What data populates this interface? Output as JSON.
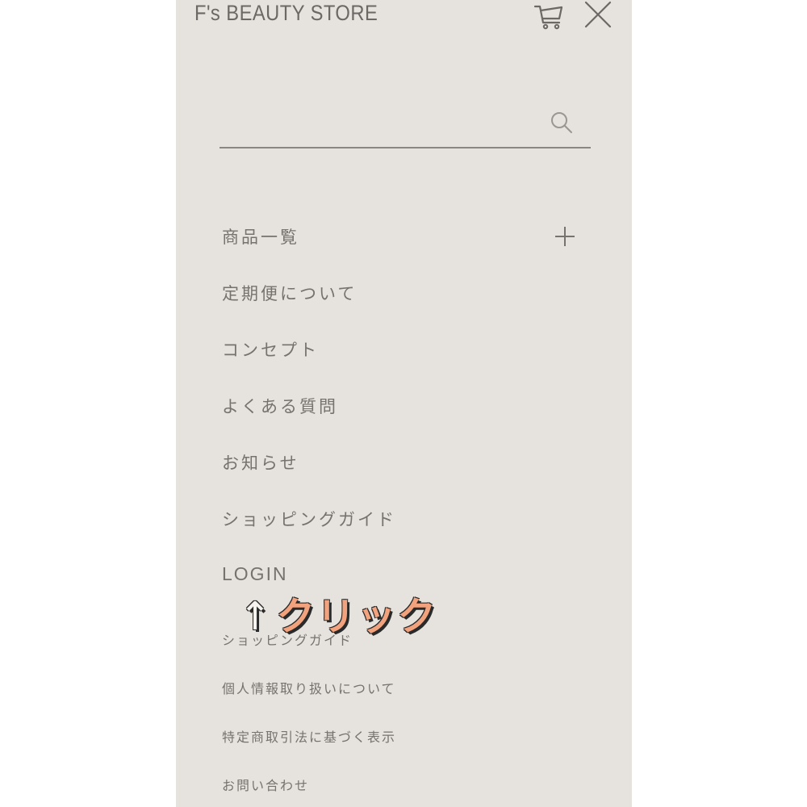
{
  "header": {
    "brand": "F's BEAUTY STORE",
    "cart_icon": "cart-icon",
    "close_icon": "close-icon"
  },
  "search": {
    "value": "",
    "placeholder": "",
    "icon": "search-icon"
  },
  "menu": {
    "items": [
      {
        "label": "商品一覧",
        "expand_icon": "plus-icon"
      },
      {
        "label": "定期便について"
      },
      {
        "label": "コンセプト"
      },
      {
        "label": "よくある質問"
      },
      {
        "label": "お知らせ"
      },
      {
        "label": "ショッピングガイド"
      },
      {
        "label": "LOGIN"
      }
    ]
  },
  "annotation": {
    "arrow": "↑",
    "text": "クリック",
    "color": "#f2a37e"
  },
  "footer_links": [
    {
      "label": "ショッピングガイド"
    },
    {
      "label": "個人情報取り扱いについて"
    },
    {
      "label": "特定商取引法に基づく表示"
    },
    {
      "label": "お問い合わせ"
    }
  ],
  "colors": {
    "panel_bg": "#e6e2dd",
    "text": "#76726e"
  }
}
